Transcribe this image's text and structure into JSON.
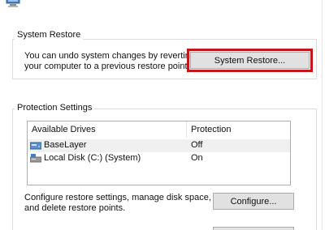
{
  "system_restore": {
    "group_title": "System Restore",
    "description_line1": "You can undo system changes by reverting",
    "description_line2": "your computer to a previous restore point.",
    "button_label": "System Restore..."
  },
  "protection_settings": {
    "group_title": "Protection Settings",
    "columns": [
      "Available Drives",
      "Protection"
    ],
    "drives": [
      {
        "name": "BaseLayer",
        "protection": "Off",
        "icon": "drive-icon"
      },
      {
        "name": "Local Disk (C:) (System)",
        "protection": "On",
        "icon": "system-drive-icon"
      }
    ],
    "configure_desc_line1": "Configure restore settings, manage disk space,",
    "configure_desc_line2": "and delete restore points.",
    "configure_button": "Configure..."
  },
  "colors": {
    "highlight": "#c4161c",
    "button_bg": "#e1e1e1",
    "selected_row": "#f0f0f0"
  }
}
